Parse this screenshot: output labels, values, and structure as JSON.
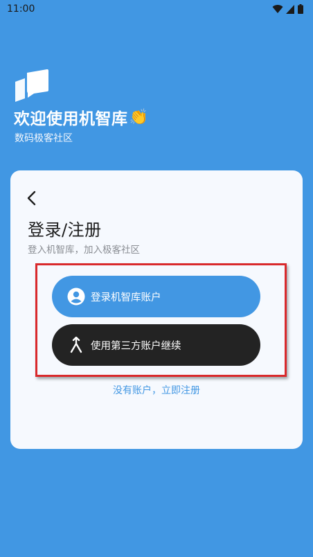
{
  "status_bar": {
    "time": "11:00",
    "icons": [
      "wifi-icon",
      "signal-icon",
      "battery-icon"
    ]
  },
  "header": {
    "logo_icon": "chat-bubbles-logo",
    "title": "欢迎使用机智库",
    "title_emoji": "👏",
    "subtitle": "数码极客社区"
  },
  "card": {
    "back_icon": "chevron-left-icon",
    "title": "登录/注册",
    "subtitle": "登入机智库，加入极客社区",
    "login_button": {
      "label": "登录机智库账户",
      "icon": "user-circle-icon"
    },
    "third_party_button": {
      "label": "使用第三方账户继续",
      "icon": "merge-arrow-icon"
    },
    "register_link": "没有账户，立即注册"
  },
  "colors": {
    "background": "#4197e3",
    "card": "#f6f9fe",
    "primary_button": "#4297e3",
    "dark_button": "#232323",
    "highlight": "#d9292c",
    "link": "#4297e3"
  }
}
